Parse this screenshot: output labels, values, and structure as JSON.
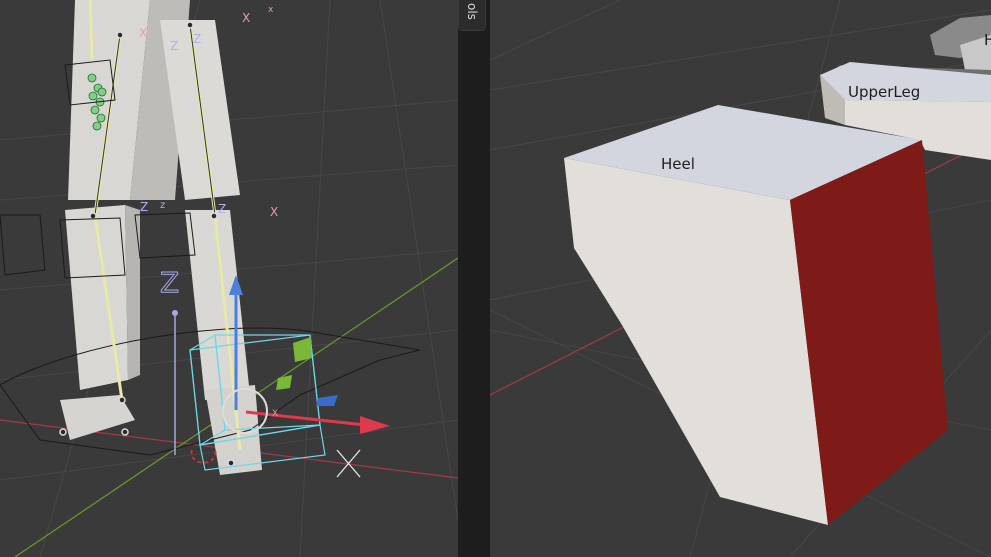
{
  "left_viewport": {
    "axis_labels": {
      "x1": "X",
      "z1": "Z",
      "z2": "Z",
      "x2": "X",
      "z3": "Z",
      "z4": "z",
      "z5": "Z",
      "x3": "X",
      "gizmo_z": "Z",
      "gizmo_x": "X"
    }
  },
  "side_tab": {
    "label": "ols"
  },
  "right_viewport": {
    "objects": {
      "heel": "Heel",
      "upper_leg": "UpperLeg",
      "partial": "H"
    }
  },
  "colors": {
    "viewport_bg": "#3a3a3a",
    "grid": "#4a4a4a",
    "x_axis": "#a23a48",
    "y_axis": "#6a9a2a",
    "mesh_light": "#e2dfda",
    "mesh_top": "#d3d6de",
    "selected_face": "#7e1a17",
    "bone_select": "#6fd6e6"
  }
}
